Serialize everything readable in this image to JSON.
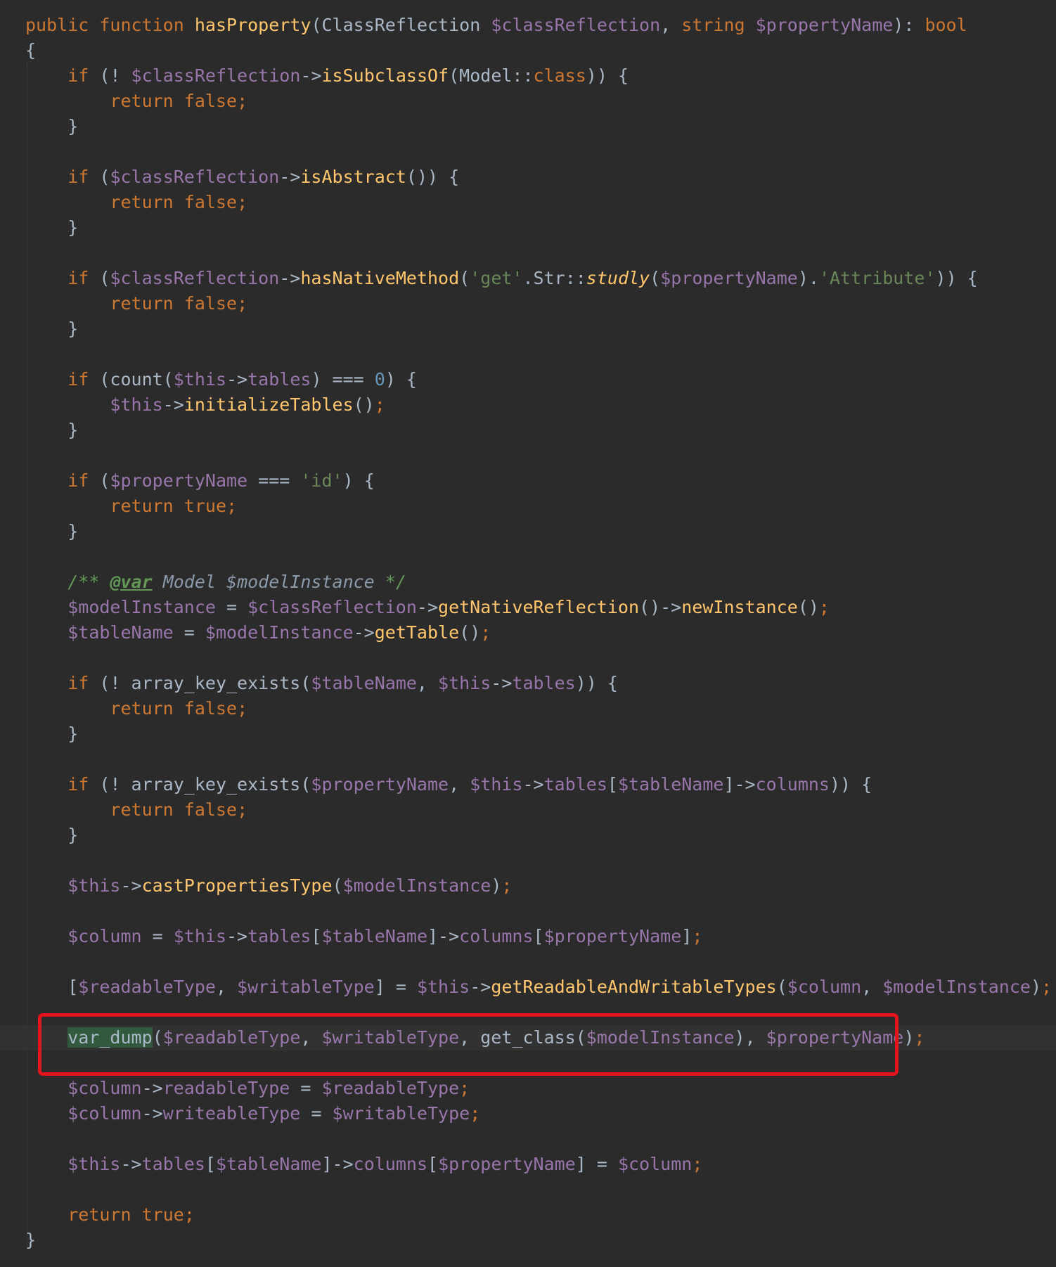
{
  "editor": {
    "language": "php",
    "colors": {
      "background": "#2b2b2b",
      "keyword": "#cc7832",
      "function": "#ffc66d",
      "variable": "#9876aa",
      "string": "#6a8759",
      "number": "#6897bb",
      "annotation_box": "#e4141b"
    },
    "lines": [
      "public function hasProperty(ClassReflection $classReflection, string $propertyName): bool",
      "{",
      "    if (! $classReflection->isSubclassOf(Model::class)) {",
      "        return false;",
      "    }",
      "",
      "    if ($classReflection->isAbstract()) {",
      "        return false;",
      "    }",
      "",
      "    if ($classReflection->hasNativeMethod('get'.Str::studly($propertyName).'Attribute')) {",
      "        return false;",
      "    }",
      "",
      "    if (count($this->tables) === 0) {",
      "        $this->initializeTables();",
      "    }",
      "",
      "    if ($propertyName === 'id') {",
      "        return true;",
      "    }",
      "",
      "    /** @var Model $modelInstance */",
      "    $modelInstance = $classReflection->getNativeReflection()->newInstance();",
      "    $tableName = $modelInstance->getTable();",
      "",
      "    if (! array_key_exists($tableName, $this->tables)) {",
      "        return false;",
      "    }",
      "",
      "    if (! array_key_exists($propertyName, $this->tables[$tableName]->columns)) {",
      "        return false;",
      "    }",
      "",
      "    $this->castPropertiesType($modelInstance);",
      "",
      "    $column = $this->tables[$tableName]->columns[$propertyName];",
      "",
      "    [$readableType, $writableType] = $this->getReadableAndWritableTypes($column, $modelInstance);",
      "",
      "    var_dump($readableType, $writableType, get_class($modelInstance), $propertyName);",
      "",
      "    $column->readableType = $readableType;",
      "    $column->writeableType = $writableType;",
      "",
      "    $this->tables[$tableName]->columns[$propertyName] = $column;",
      "",
      "    return true;",
      "}"
    ],
    "highlighted_line_index": 40
  }
}
